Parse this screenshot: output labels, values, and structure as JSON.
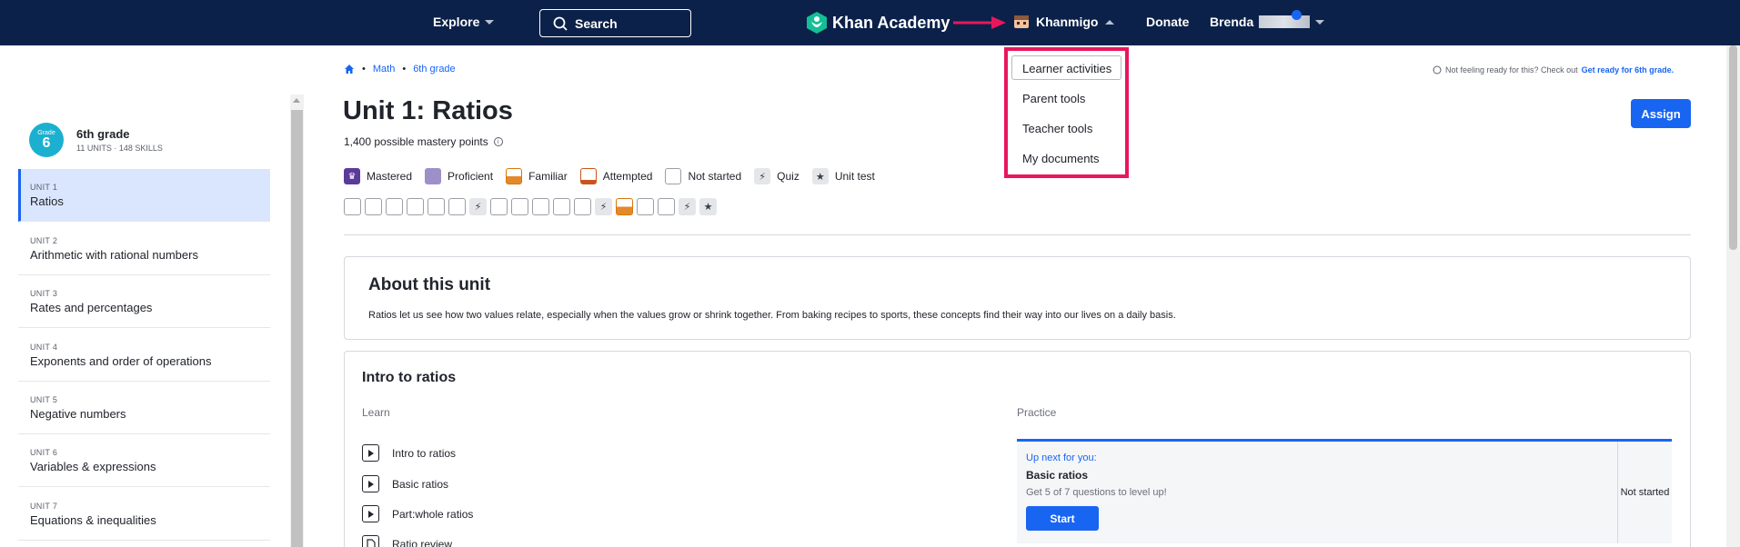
{
  "nav": {
    "explore": "Explore",
    "search": "Search",
    "brand": "Khan Academy",
    "khanmigo": "Khanmigo",
    "donate": "Donate",
    "user": "Brenda"
  },
  "dropdown": {
    "items": [
      "Learner activities",
      "Parent tools",
      "Teacher tools",
      "My documents"
    ]
  },
  "sidebar": {
    "grade_badge_label": "Grade",
    "grade_number": "6",
    "grade_title": "6th grade",
    "grade_sub": "11 UNITS · 148 SKILLS",
    "units": [
      {
        "label": "UNIT 1",
        "name": "Ratios"
      },
      {
        "label": "UNIT 2",
        "name": "Arithmetic with rational numbers"
      },
      {
        "label": "UNIT 3",
        "name": "Rates and percentages"
      },
      {
        "label": "UNIT 4",
        "name": "Exponents and order of operations"
      },
      {
        "label": "UNIT 5",
        "name": "Negative numbers"
      },
      {
        "label": "UNIT 6",
        "name": "Variables & expressions"
      },
      {
        "label": "UNIT 7",
        "name": "Equations & inequalities"
      }
    ]
  },
  "breadcrumb": {
    "item1": "Math",
    "item2": "6th grade",
    "sep": "•"
  },
  "ready": {
    "text": "Not feeling ready for this? Check out",
    "link": "Get ready for 6th grade."
  },
  "main": {
    "title": "Unit 1: Ratios",
    "mastery_points": "1,400 possible mastery points",
    "assign": "Assign"
  },
  "legend": {
    "mastered": "Mastered",
    "proficient": "Proficient",
    "familiar": "Familiar",
    "attempted": "Attempted",
    "not_started": "Not started",
    "quiz": "Quiz",
    "unit_test": "Unit test"
  },
  "about": {
    "title": "About this unit",
    "text": "Ratios let us see how two values relate, especially when the values grow or shrink together. From baking recipes to sports, these concepts find their way into our lives on a daily basis."
  },
  "intro": {
    "title": "Intro to ratios",
    "learn_head": "Learn",
    "practice_head": "Practice",
    "learn_items": [
      "Intro to ratios",
      "Basic ratios",
      "Part:whole ratios",
      "Ratio review"
    ],
    "up_next": "Up next for you:",
    "practice_title": "Basic ratios",
    "practice_sub": "Get 5 of 7 questions to level up!",
    "start": "Start",
    "status": "Not started"
  },
  "colors": {
    "nav_bg": "#0b2149",
    "accent": "#1865f2",
    "highlight": "#e8175d"
  }
}
